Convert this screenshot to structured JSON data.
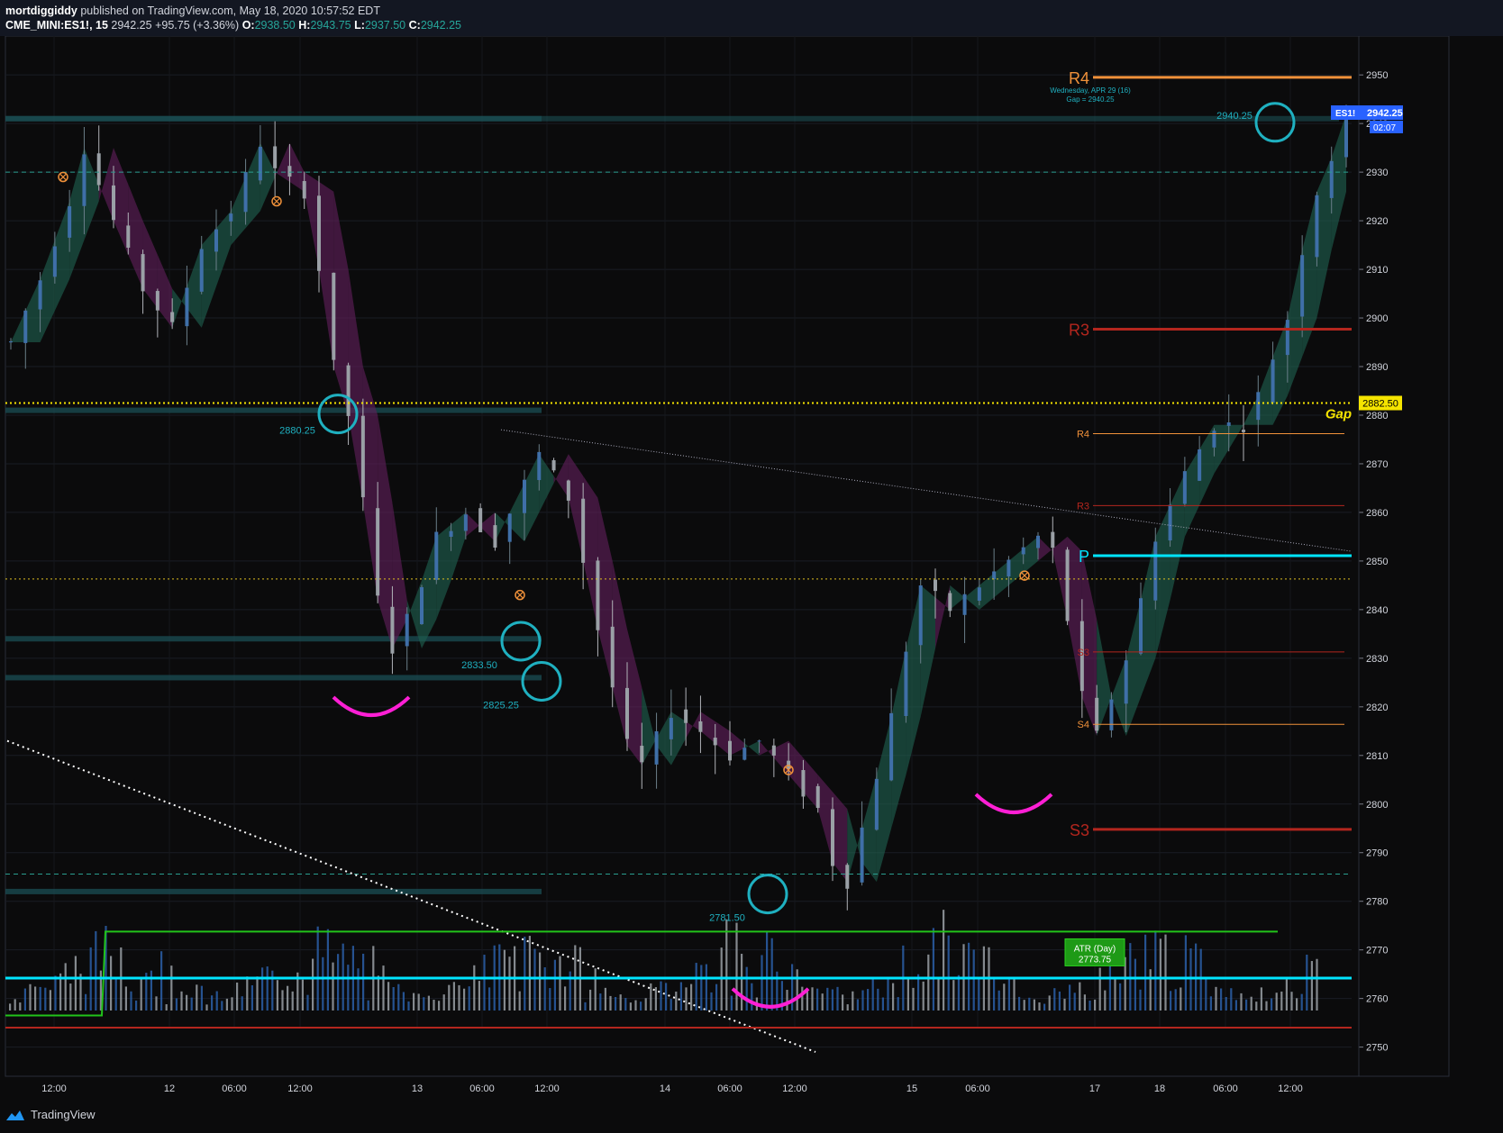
{
  "header": {
    "author": "mortdiggiddy",
    "published_text": "published on TradingView.com, May 18, 2020 10:57:52 EDT",
    "symbol": "CME_MINI:ES1!, 15",
    "last": "2942.25",
    "change": "+95.75 (+3.36%)",
    "o_label": "O:",
    "o": "2938.50",
    "h_label": "H:",
    "h": "2943.75",
    "l_label": "L:",
    "l": "2937.50",
    "c_label": "C:",
    "c": "2942.25"
  },
  "footer": {
    "brand": "TradingView",
    "logo_icon": "tradingview-logo-icon"
  },
  "price_badge": {
    "symbol": "ES1!",
    "price": "2942.25",
    "countdown": "02:07"
  },
  "colors": {
    "background": "#0b0b0c",
    "up": "#26a69a",
    "down": "#ef5350",
    "cyan": "#00e5ff",
    "magenta": "#ff1fd5",
    "orange": "#f0913a",
    "red": "#b3261e",
    "yellow": "#f5e400",
    "green": "#22c31a"
  },
  "chart_data": {
    "type": "candlestick",
    "interval": "15",
    "ylim": [
      2744,
      2958
    ],
    "y_ticks": [
      2750,
      2760,
      2770,
      2780,
      2790,
      2800,
      2810,
      2820,
      2830,
      2840,
      2850,
      2860,
      2870,
      2880,
      2890,
      2900,
      2910,
      2920,
      2930,
      2940,
      2950
    ],
    "x_tick_labels": [
      "12:00",
      "12",
      "06:00",
      "12:00",
      "13",
      "06:00",
      "12:00",
      "14",
      "06:00",
      "12:00",
      "15",
      "06:00",
      "17",
      "18",
      "06:00",
      "12:00"
    ],
    "price_path": [
      [
        0,
        2895
      ],
      [
        2,
        2908
      ],
      [
        4,
        2924
      ],
      [
        5,
        2935
      ],
      [
        7,
        2920
      ],
      [
        9,
        2906
      ],
      [
        11,
        2898
      ],
      [
        13,
        2915
      ],
      [
        15,
        2922
      ],
      [
        17,
        2936
      ],
      [
        18,
        2930
      ],
      [
        20,
        2926
      ],
      [
        21,
        2910
      ],
      [
        22,
        2890
      ],
      [
        23,
        2880
      ],
      [
        24,
        2862
      ],
      [
        25,
        2842
      ],
      [
        26,
        2832
      ],
      [
        27,
        2838
      ],
      [
        28,
        2846
      ],
      [
        29,
        2855
      ],
      [
        31,
        2860
      ],
      [
        33,
        2854
      ],
      [
        35,
        2866
      ],
      [
        36,
        2872
      ],
      [
        38,
        2863
      ],
      [
        39,
        2850
      ],
      [
        40,
        2836
      ],
      [
        41,
        2824
      ],
      [
        42,
        2812
      ],
      [
        43,
        2808
      ],
      [
        45,
        2819
      ],
      [
        47,
        2815
      ],
      [
        49,
        2810
      ],
      [
        51,
        2813
      ],
      [
        53,
        2806
      ],
      [
        55,
        2799
      ],
      [
        56,
        2788
      ],
      [
        57,
        2784
      ],
      [
        58,
        2795
      ],
      [
        59,
        2806
      ],
      [
        60,
        2818
      ],
      [
        61,
        2832
      ],
      [
        62,
        2845
      ],
      [
        64,
        2840
      ],
      [
        66,
        2845
      ],
      [
        68,
        2850
      ],
      [
        70,
        2855
      ],
      [
        71,
        2852
      ],
      [
        72,
        2838
      ],
      [
        73,
        2822
      ],
      [
        74,
        2814
      ],
      [
        75,
        2822
      ],
      [
        76,
        2830
      ],
      [
        77,
        2842
      ],
      [
        78,
        2855
      ],
      [
        80,
        2868
      ],
      [
        82,
        2878
      ],
      [
        84,
        2878
      ],
      [
        85,
        2884
      ],
      [
        86,
        2892
      ],
      [
        87,
        2900
      ],
      [
        88,
        2914
      ],
      [
        89,
        2926
      ],
      [
        90,
        2933
      ],
      [
        91,
        2942
      ]
    ],
    "volume_bars_per_session": 20,
    "horizontal_levels": [
      {
        "label": "R4",
        "value": 2949.5,
        "style": "solid",
        "color": "#f0913a",
        "width": 3
      },
      {
        "label": "R3",
        "value": 2897.7,
        "style": "solid",
        "color": "#b3261e",
        "width": 3
      },
      {
        "label": "P",
        "value": 2851.1,
        "style": "solid",
        "color": "#00e5ff",
        "width": 3
      },
      {
        "label": "S3",
        "value": 2794.8,
        "style": "solid",
        "color": "#b3261e",
        "width": 3
      },
      {
        "label": "R4",
        "value": 2876.2,
        "style": "thin",
        "color": "#f0913a",
        "width": 1
      },
      {
        "label": "R3",
        "value": 2861.4,
        "style": "thin",
        "color": "#b3261e",
        "width": 1
      },
      {
        "label": "S3",
        "value": 2831.3,
        "style": "thin",
        "color": "#b3261e",
        "width": 1
      },
      {
        "label": "S4",
        "value": 2816.4,
        "style": "thin",
        "color": "#f0913a",
        "width": 1
      },
      {
        "label": "Gap",
        "value": 2882.5,
        "style": "dotted",
        "color": "#f5e400",
        "width": 2
      },
      {
        "label": "",
        "value": 2846.3,
        "style": "dotted",
        "color": "#e0c020",
        "width": 1
      },
      {
        "label": "",
        "value": 2930.0,
        "style": "dashed",
        "color": "#2a9d8f",
        "width": 1
      },
      {
        "label": "",
        "value": 2785.6,
        "style": "dashed",
        "color": "#2a9d8f",
        "width": 1
      }
    ],
    "gap_price": "2882.50",
    "gap_label": "Gap",
    "annotations": {
      "circle_levels": [
        {
          "label": "2880.25",
          "value": 2880.25
        },
        {
          "label": "2833.50",
          "value": 2833.5
        },
        {
          "label": "2825.25",
          "value": 2825.25
        },
        {
          "label": "2781.50",
          "value": 2781.5
        },
        {
          "label": "2940.25",
          "value": 2940.25
        }
      ],
      "gap_note_line1": "Wednesday, APR 29 (16)",
      "gap_note_line2": "Gap = 2940.25",
      "atr_label": "ATR (Day)",
      "atr_value": "2773.75",
      "atr_step_low": 2756.5,
      "atr_step_high": 2773.75,
      "cyan_volume_line": 2764.2,
      "red_volume_line": 2754.0
    }
  }
}
